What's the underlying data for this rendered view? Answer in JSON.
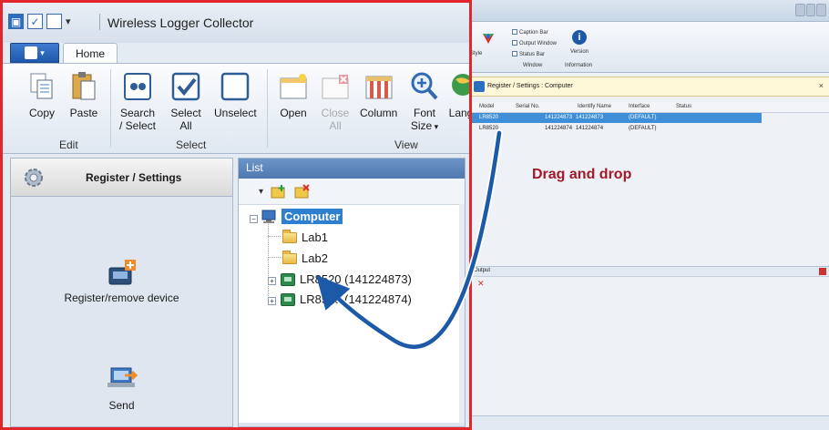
{
  "colors": {
    "highlight_border": "#e2262b",
    "arrow": "#1c5aa8",
    "annotation": "#a0192b",
    "selection": "#3f8fd8"
  },
  "app": {
    "title": "Wireless Logger Collector",
    "tabs": [
      "Home"
    ]
  },
  "ribbon": {
    "groups": [
      {
        "label": "Edit",
        "buttons": [
          {
            "label": "Copy",
            "icon": "copy-icon"
          },
          {
            "label": "Paste",
            "icon": "paste-icon"
          }
        ]
      },
      {
        "label": "Select",
        "buttons": [
          {
            "label": "Search\n/ Select",
            "icon": "search-select-icon"
          },
          {
            "label": "Select\nAll",
            "icon": "checkbox-checked-icon"
          },
          {
            "label": "Unselect",
            "icon": "checkbox-empty-icon"
          }
        ]
      },
      {
        "label": "View",
        "buttons": [
          {
            "label": "Open",
            "icon": "open-window-icon"
          },
          {
            "label": "Close\nAll",
            "icon": "close-window-icon",
            "disabled": true
          },
          {
            "label": "Column",
            "icon": "column-icon"
          },
          {
            "label": "Font\nSize",
            "icon": "zoom-icon",
            "dropdown": true
          },
          {
            "label": "Lang",
            "icon": "language-icon"
          }
        ]
      }
    ]
  },
  "nav": {
    "header": "Register / Settings",
    "items": [
      {
        "label": "Register/remove device",
        "icon": "device-add-icon"
      },
      {
        "label": "Send",
        "icon": "laptop-send-icon"
      }
    ]
  },
  "list": {
    "header": "List",
    "tree": {
      "root": "Computer",
      "children": [
        "Lab1",
        "Lab2",
        "LR8520 (141224873)",
        "LR8520 (141224874)"
      ]
    }
  },
  "annotation": {
    "text": "Drag and drop"
  },
  "background_window": {
    "ribbon": {
      "view_items": [
        "Caption Bar",
        "Output Window",
        "Status Bar"
      ],
      "groups": [
        "Window",
        "Information"
      ],
      "version_label": "Version",
      "style_label": "Style"
    },
    "panel_title": "Register / Settings : Computer",
    "columns": [
      "Model",
      "Serial No.",
      "Identify Name",
      "Interface",
      "Status"
    ],
    "rows": [
      {
        "model": "LR8520",
        "serial": "141224873",
        "identify": "141224873",
        "interface": "(DEFAULT)",
        "status": ""
      },
      {
        "model": "LR8520",
        "serial": "141224874",
        "identify": "141224874",
        "interface": "(DEFAULT)",
        "status": ""
      }
    ],
    "output_label": "Output"
  }
}
